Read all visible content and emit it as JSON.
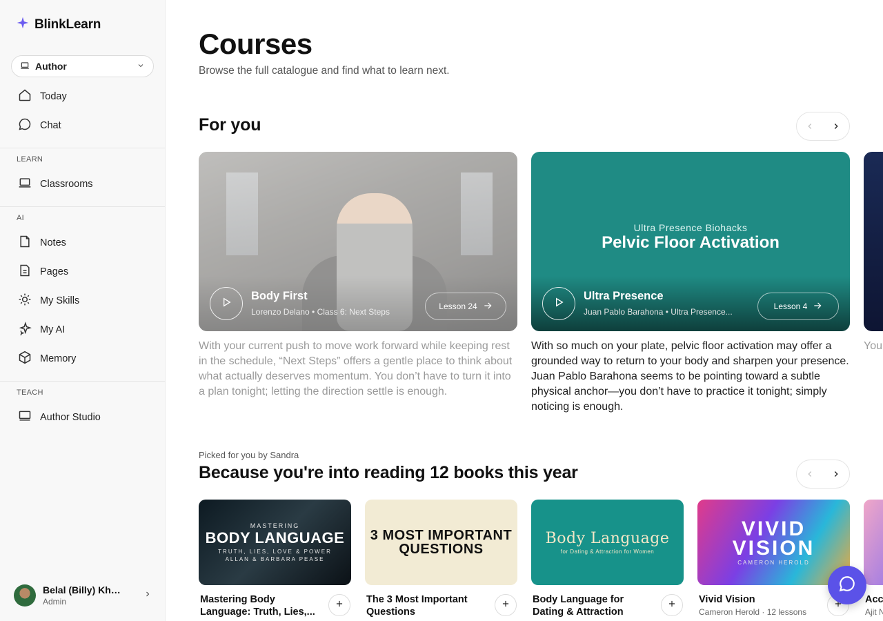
{
  "app": {
    "name": "BlinkLearn"
  },
  "sidebar": {
    "role_selector": {
      "value": "Author"
    },
    "top_items": [
      {
        "label": "Today",
        "icon": "home-icon"
      },
      {
        "label": "Chat",
        "icon": "chat-bubble-icon"
      }
    ],
    "sections": [
      {
        "heading": "LEARN",
        "items": [
          {
            "label": "Classrooms",
            "icon": "laptop-icon"
          }
        ]
      },
      {
        "heading": "AI",
        "items": [
          {
            "label": "Notes",
            "icon": "note-icon"
          },
          {
            "label": "Pages",
            "icon": "page-icon"
          },
          {
            "label": "My Skills",
            "icon": "skills-icon"
          },
          {
            "label": "My AI",
            "icon": "sparkles-icon"
          },
          {
            "label": "Memory",
            "icon": "memory-cube-icon"
          }
        ]
      },
      {
        "heading": "TEACH",
        "items": [
          {
            "label": "Author Studio",
            "icon": "monitor-icon"
          }
        ]
      }
    ],
    "user": {
      "name": "Belal (Billy) Kha...",
      "role": "Admin"
    }
  },
  "main": {
    "title": "Courses",
    "subtitle": "Browse the full catalogue and find what to learn next.",
    "for_you": {
      "title": "For you",
      "cards": [
        {
          "title": "Body First",
          "meta": "Lorenzo Delano • Class 6: Next Steps",
          "lesson": "Lesson 24",
          "description": "With your current push to move work forward while keeping rest in the schedule, “Next Steps” offers a gentle place to think about what actually deserves momentum. You don’t have to turn it into a plan tonight; letting the direction settle is enough."
        },
        {
          "title": "Ultra Presence",
          "cover_kicker": "Ultra Presence Biohacks",
          "cover_title": "Pelvic Floor Activation",
          "meta": "Juan Pablo Barahona • Ultra Presence...",
          "lesson": "Lesson 4",
          "description": "With so much on your plate, pelvic floor activation may offer a grounded way to return to your body and sharpen your presence. Juan Pablo Barahona seems to be pointing toward a subtle physical anchor—you don’t have to practice it tonight; simply noticing is enough."
        },
        {
          "description_peek": "You Sou tow to b brea"
        }
      ]
    },
    "because": {
      "kicker": "Picked for you by Sandra",
      "title": "Because you're into reading 12 books this year",
      "books": [
        {
          "title": "Mastering Body Language: Truth, Lies,...",
          "cover_small": "MASTERING",
          "cover_big": "BODY LANGUAGE",
          "cover_line": "TRUTH, LIES, LOVE & POWER",
          "cover_author": "ALLAN & BARBARA PEASE"
        },
        {
          "title": "The 3 Most Important Questions",
          "cover_big": "3 MOST IMPORTANT QUESTIONS"
        },
        {
          "title": "Body Language for Dating & Attraction",
          "cover_big": "Body Language",
          "cover_line": "for Dating & Attraction for Women"
        },
        {
          "title": "Vivid Vision",
          "meta": "Cameron Herold · 12 lessons",
          "cover_big": "VIVID VISION",
          "cover_line": "CAMERON HEROLD"
        },
        {
          "title": "Acc",
          "meta": "Ajit N"
        }
      ]
    }
  },
  "colors": {
    "accent": "#5b52e8",
    "teal": "#1f8b84"
  }
}
